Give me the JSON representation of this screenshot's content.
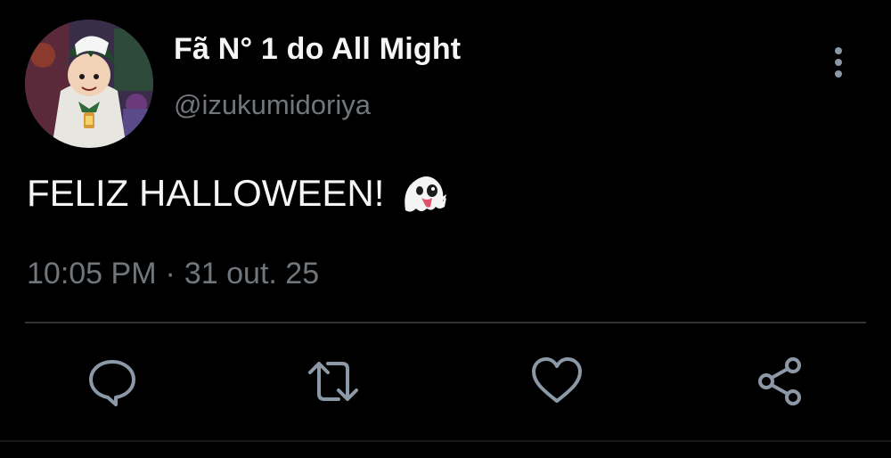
{
  "author": {
    "display_name": "Fã N° 1 do All Might",
    "handle": "@izukumidoriya",
    "avatar_icon": "avatar-image"
  },
  "tweet": {
    "text": "FELIZ HALLOWEEN!",
    "emoji": "ghost-emoji"
  },
  "meta": {
    "time": "10:05 PM",
    "separator": "·",
    "date": "31 out. 25"
  },
  "actions": [
    {
      "name": "reply",
      "icon": "reply-icon"
    },
    {
      "name": "retweet",
      "icon": "retweet-icon"
    },
    {
      "name": "like",
      "icon": "heart-icon"
    },
    {
      "name": "share",
      "icon": "share-icon"
    }
  ],
  "colors": {
    "background": "#000000",
    "primary_text": "#f5f5f5",
    "secondary_text": "#71767b",
    "divider": "#2f3336",
    "icon": "#71767b"
  }
}
